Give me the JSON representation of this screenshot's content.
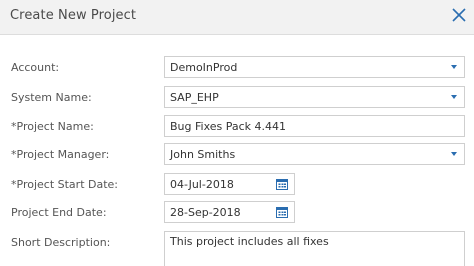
{
  "dialog": {
    "title": "Create New Project"
  },
  "form": {
    "account": {
      "label": "Account:",
      "value": "DemoInProd"
    },
    "system_name": {
      "label": "System Name:",
      "value": "SAP_EHP"
    },
    "project_name": {
      "label": "*Project Name:",
      "value": "Bug Fixes Pack 4.441"
    },
    "project_manager": {
      "label": "*Project Manager:",
      "value": "John Smiths"
    },
    "start_date": {
      "label": "*Project Start Date:",
      "value": "04-Jul-2018"
    },
    "end_date": {
      "label": "Project End Date:",
      "value": "28-Sep-2018"
    },
    "short_description": {
      "label": "Short Description:",
      "value": "This project includes all fixes"
    }
  },
  "colors": {
    "accent": "#2a6db0",
    "header_bg": "#f2f2f2",
    "border": "#cfcfcf"
  },
  "icons": {
    "close": "close-icon",
    "dropdown": "chevron-down-icon",
    "calendar": "calendar-icon"
  }
}
